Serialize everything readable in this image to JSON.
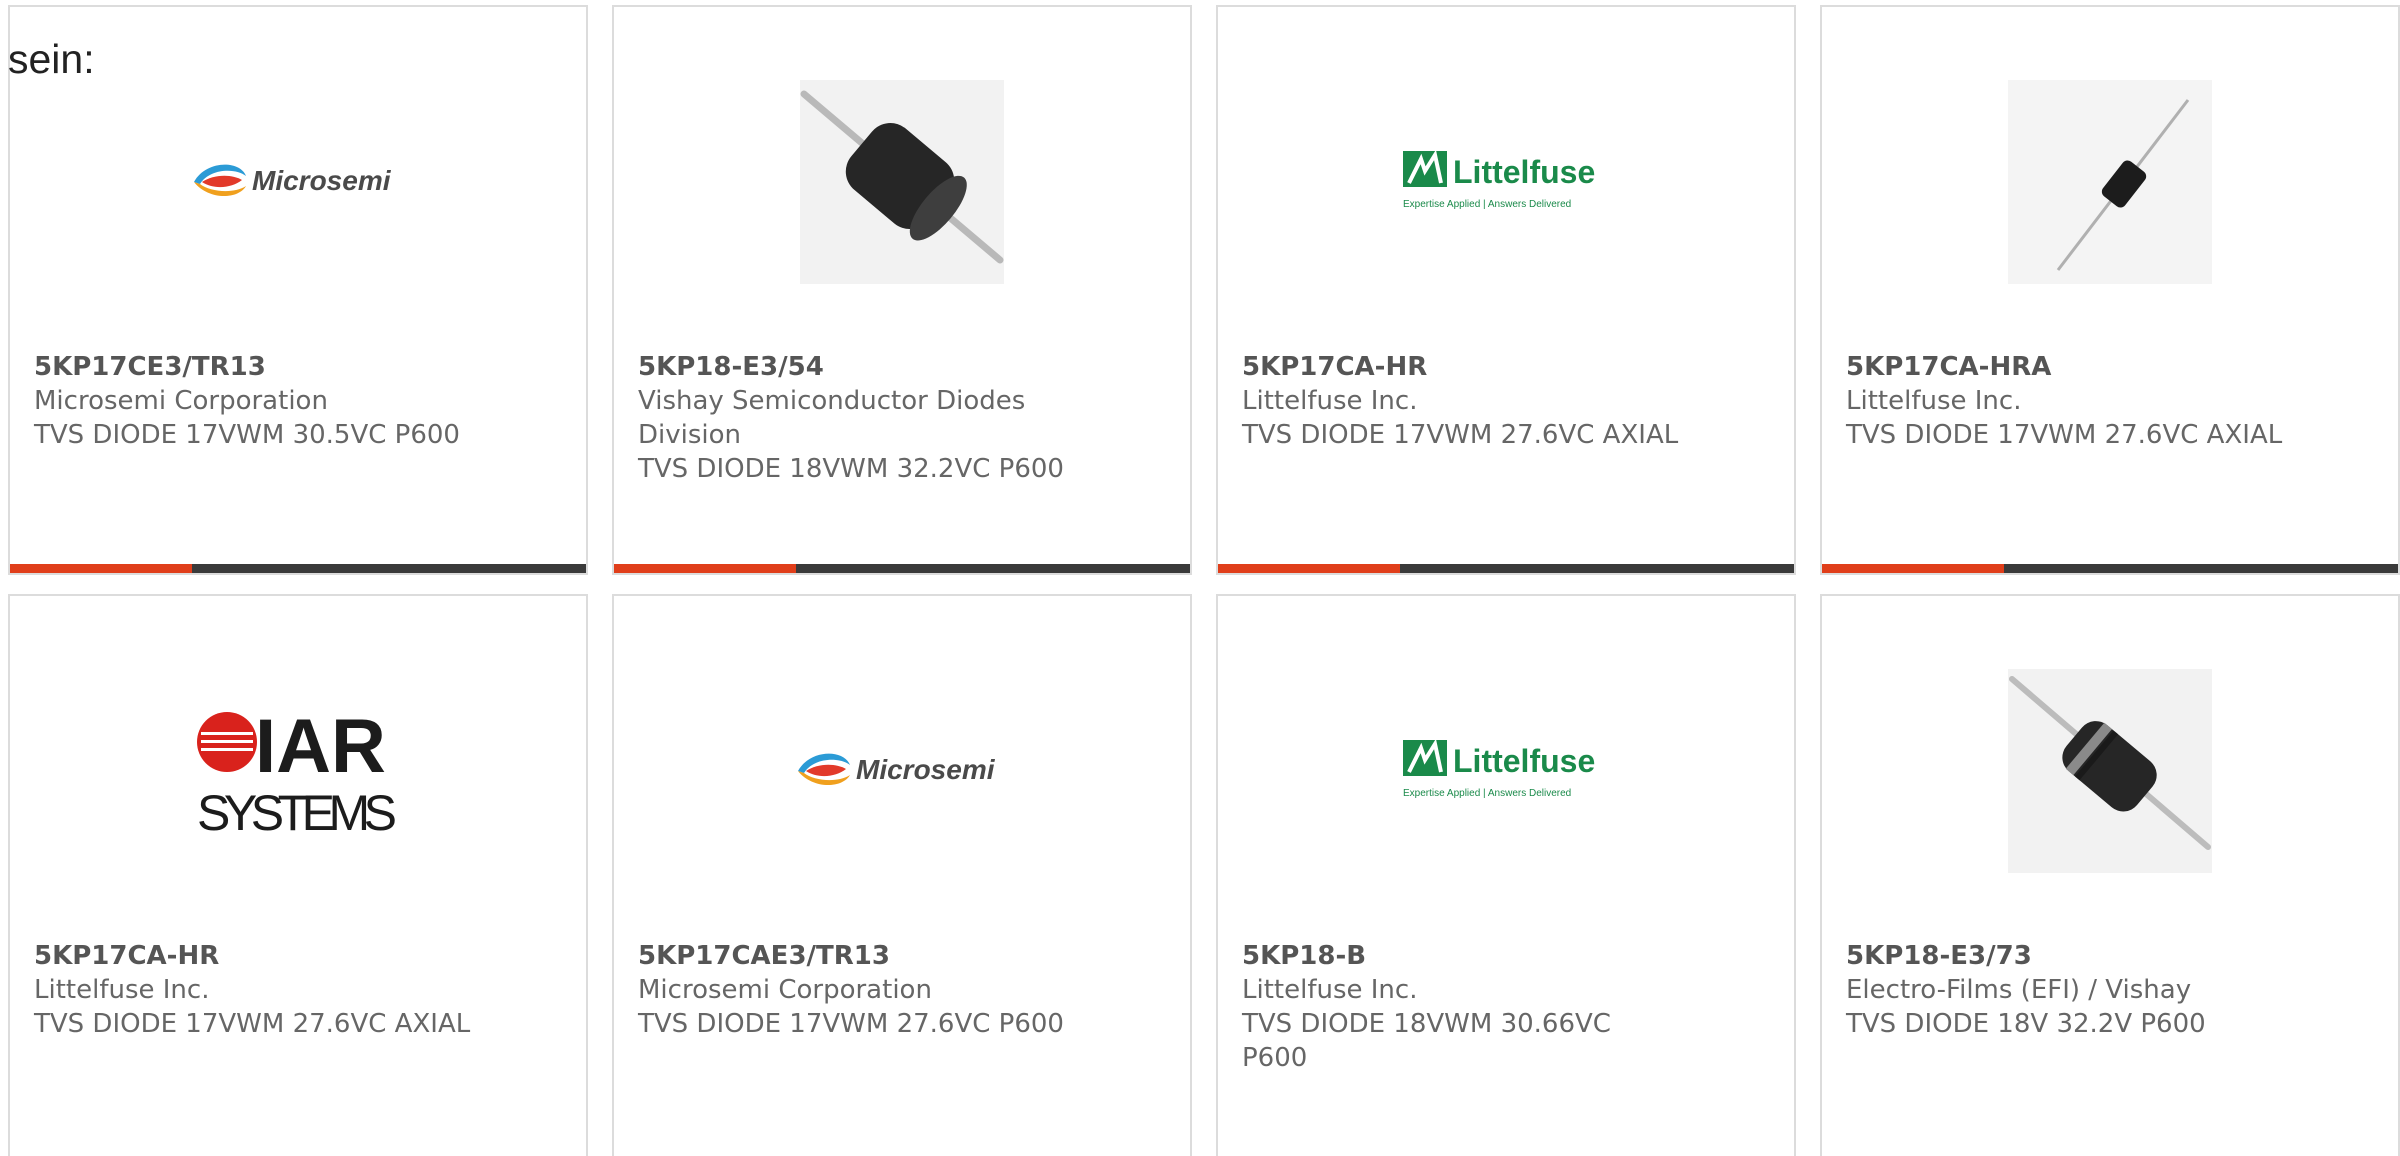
{
  "intro_text": "sein:",
  "colors": {
    "accent": "#e03e1a",
    "bar": "#3a3a3a",
    "border": "#dcdcdc",
    "littelfuse_green": "#1a8a4a",
    "iar_red": "#d9221c"
  },
  "products": [
    {
      "part_number": "5KP17CE3/TR13",
      "manufacturer": "Microsemi Corporation",
      "description": "TVS DIODE 17VWM 30.5VC P600",
      "image": "microsemi-logo"
    },
    {
      "part_number": "5KP18-E3/54",
      "manufacturer": "Vishay Semiconductor Diodes Division",
      "description": "TVS DIODE 18VWM 32.2VC P600",
      "image": "diode-photo-large"
    },
    {
      "part_number": "5KP17CA-HR",
      "manufacturer": "Littelfuse Inc.",
      "description": "TVS DIODE 17VWM 27.6VC AXIAL",
      "image": "littelfuse-logo"
    },
    {
      "part_number": "5KP17CA-HRA",
      "manufacturer": "Littelfuse Inc.",
      "description": "TVS DIODE 17VWM 27.6VC AXIAL",
      "image": "diode-photo-small"
    },
    {
      "part_number": "5KP17CA-HR",
      "manufacturer": "Littelfuse Inc.",
      "description": "TVS DIODE 17VWM 27.6VC AXIAL",
      "image": "iar-systems-logo"
    },
    {
      "part_number": "5KP17CAE3/TR13",
      "manufacturer": "Microsemi Corporation",
      "description": "TVS DIODE 17VWM 27.6VC P600",
      "image": "microsemi-logo"
    },
    {
      "part_number": "5KP18-B",
      "manufacturer": "Littelfuse Inc.",
      "description": "TVS DIODE 18VWM 30.66VC P600",
      "image": "littelfuse-logo"
    },
    {
      "part_number": "5KP18-E3/73",
      "manufacturer": "Electro-Films (EFI) / Vishay",
      "description": "TVS DIODE 18V 32.2V P600",
      "image": "diode-photo-band"
    }
  ],
  "logos": {
    "microsemi": "Microsemi",
    "littelfuse": "Littelfuse",
    "littelfuse_tagline": "Expertise Applied | Answers Delivered",
    "iar_top": "IAR",
    "iar_bottom": "SYSTEMS"
  }
}
